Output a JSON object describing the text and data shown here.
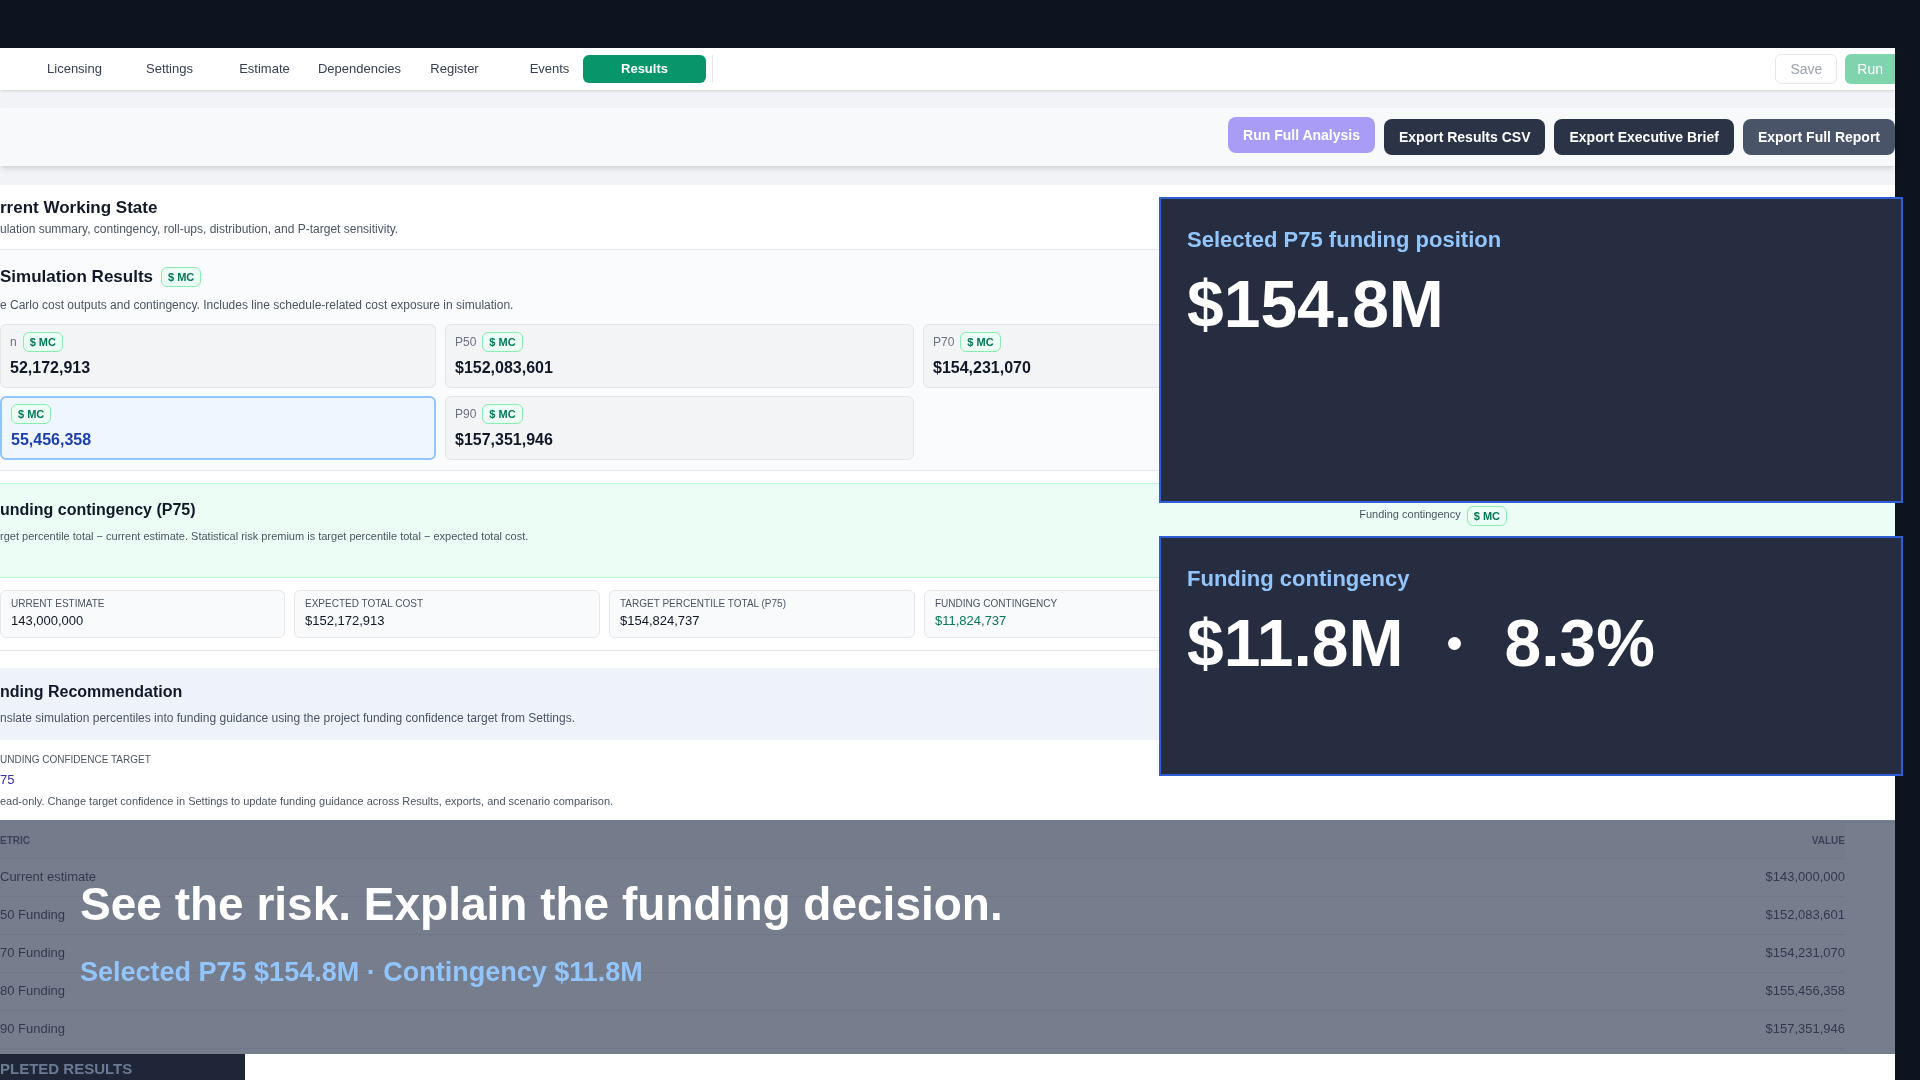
{
  "nav": {
    "tabs": [
      {
        "label": "Licensing",
        "selected": false
      },
      {
        "label": "Settings",
        "selected": false
      },
      {
        "label": "Estimate",
        "selected": false
      },
      {
        "label": "Dependencies",
        "selected": false
      },
      {
        "label": "Register",
        "selected": false
      },
      {
        "label": "Events",
        "selected": false
      },
      {
        "label": "Results",
        "selected": true
      }
    ],
    "actions": [
      {
        "label": "Save",
        "kind": "secondary"
      },
      {
        "label": "Run",
        "kind": "primary"
      }
    ]
  },
  "toolbar": {
    "buttons": [
      {
        "label": "Run Full Analysis",
        "kind": "accent"
      },
      {
        "label": "Export Results CSV",
        "kind": "dark"
      },
      {
        "label": "Export Executive Brief",
        "kind": "dark"
      },
      {
        "label": "Export Full Report",
        "kind": "slate"
      }
    ]
  },
  "working_state": {
    "title": "rrent Working State",
    "subtitle": "ulation summary, contingency, roll-ups, distribution, and P-target sensitivity."
  },
  "simulation": {
    "title": "Simulation Results",
    "badge": "$ MC",
    "subtitle": "e Carlo cost outputs and contingency. Includes line schedule-related cost exposure in simulation.",
    "cards": [
      {
        "label": "n",
        "badge": "$ MC",
        "value": "52,172,913",
        "selected": false
      },
      {
        "label": "P50",
        "badge": "$ MC",
        "value": "$152,083,601",
        "selected": false
      },
      {
        "label": "P70",
        "badge": "$ MC",
        "value": "$154,231,070",
        "selected": false
      },
      {
        "badge": "$ MC",
        "value": "55,456,358",
        "selected": true
      },
      {
        "label": "P90",
        "badge": "$ MC",
        "value": "$157,351,946",
        "selected": false
      }
    ]
  },
  "funding_contingency": {
    "title": "unding contingency (P75)",
    "description": "rget percentile total − current estimate. Statistical risk premium is target percentile total − expected total cost.",
    "side_label": "Funding contingency",
    "side_badge": "$ MC",
    "metrics": [
      {
        "label": "URRENT ESTIMATE",
        "value": "143,000,000",
        "kind": "plain"
      },
      {
        "label": "EXPECTED TOTAL COST",
        "value": "$152,172,913",
        "kind": "plain"
      },
      {
        "label": "TARGET PERCENTILE TOTAL (P75)",
        "value": "$154,824,737",
        "kind": "plain"
      },
      {
        "label": "FUNDING CONTINGENCY",
        "value": "$11,824,737",
        "kind": "highlight"
      }
    ]
  },
  "recommendation": {
    "title": "nding Recommendation",
    "description": "nslate simulation percentiles into funding guidance using the project funding confidence target from Settings.",
    "field_label": "UNDING CONFIDENCE TARGET",
    "field_value": "75",
    "note": "ead-only. Change target confidence in Settings to update funding guidance across Results, exports, and scenario comparison."
  },
  "table": {
    "columns": [
      "ETRIC",
      "VALUE"
    ],
    "rows": [
      [
        "Current estimate",
        "$143,000,000"
      ],
      [
        "50 Funding",
        "$152,083,601"
      ],
      [
        "70 Funding",
        "$154,231,070"
      ],
      [
        "80 Funding",
        "$155,456,358"
      ],
      [
        "90 Funding",
        "$157,351,946"
      ]
    ]
  },
  "bottom_tab": "PLETED RESULTS",
  "highlights": [
    {
      "title": "Selected P75 funding position",
      "values": [
        "$154.8M"
      ]
    },
    {
      "title": "Funding contingency",
      "values": [
        "$11.8M",
        "8.3%"
      ]
    }
  ],
  "caption": {
    "headline": "See the risk. Explain the funding decision.",
    "subline": "Selected P75 $154.8M · Contingency $11.8M"
  }
}
